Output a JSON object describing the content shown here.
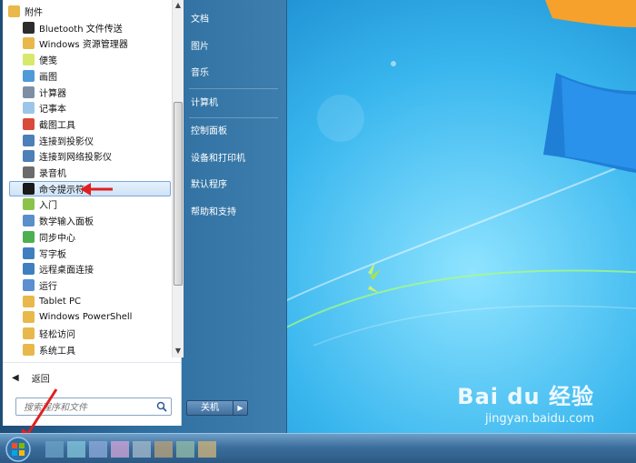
{
  "start_menu": {
    "programs": [
      {
        "label": "附件",
        "icon": "folder-icon",
        "color": "#e8b84a",
        "indent": false
      },
      {
        "label": "Bluetooth 文件传送",
        "icon": "bluetooth-icon",
        "color": "#2c2c2c",
        "indent": true
      },
      {
        "label": "Windows 资源管理器",
        "icon": "explorer-icon",
        "color": "#e8b84a",
        "indent": true
      },
      {
        "label": "便笺",
        "icon": "sticky-notes-icon",
        "color": "#d8e86a",
        "indent": true
      },
      {
        "label": "画图",
        "icon": "paint-icon",
        "color": "#4f9ad8",
        "indent": true
      },
      {
        "label": "计算器",
        "icon": "calculator-icon",
        "color": "#7e8fa3",
        "indent": true
      },
      {
        "label": "记事本",
        "icon": "notepad-icon",
        "color": "#9bc6e8",
        "indent": true
      },
      {
        "label": "截图工具",
        "icon": "snipping-tool-icon",
        "color": "#d94a3a",
        "indent": true
      },
      {
        "label": "连接到投影仪",
        "icon": "projector-icon",
        "color": "#4d7fb8",
        "indent": true
      },
      {
        "label": "连接到网络投影仪",
        "icon": "network-projector-icon",
        "color": "#4d7fb8",
        "indent": true
      },
      {
        "label": "录音机",
        "icon": "microphone-icon",
        "color": "#6b6b6b",
        "indent": true
      },
      {
        "label": "命令提示符",
        "icon": "cmd-icon",
        "color": "#1a1a1a",
        "indent": true,
        "selected": true
      },
      {
        "label": "入门",
        "icon": "getting-started-icon",
        "color": "#8bc34a",
        "indent": true
      },
      {
        "label": "数学输入面板",
        "icon": "math-input-icon",
        "color": "#5a8fc9",
        "indent": true
      },
      {
        "label": "同步中心",
        "icon": "sync-center-icon",
        "color": "#4caf50",
        "indent": true
      },
      {
        "label": "写字板",
        "icon": "wordpad-icon",
        "color": "#3f7fc0",
        "indent": true
      },
      {
        "label": "远程桌面连接",
        "icon": "remote-desktop-icon",
        "color": "#3f7fc0",
        "indent": true
      },
      {
        "label": "运行",
        "icon": "run-icon",
        "color": "#5b8fd1",
        "indent": true
      },
      {
        "label": "Tablet PC",
        "icon": "folder-icon",
        "color": "#e8b84a",
        "indent": true
      },
      {
        "label": "Windows PowerShell",
        "icon": "folder-icon",
        "color": "#e8b84a",
        "indent": true
      },
      {
        "label": "轻松访问",
        "icon": "folder-icon",
        "color": "#e8b84a",
        "indent": true
      },
      {
        "label": "系统工具",
        "icon": "folder-icon",
        "color": "#e8b84a",
        "indent": true
      }
    ],
    "back_label": "返回",
    "search_placeholder": "搜索程序和文件",
    "right_items": [
      "文档",
      "图片",
      "音乐",
      "计算机",
      "控制面板",
      "设备和打印机",
      "默认程序",
      "帮助和支持"
    ],
    "shutdown_label": "关机"
  },
  "watermark": {
    "logo": "Bai du 经验",
    "url": "jingyan.baidu.com"
  }
}
